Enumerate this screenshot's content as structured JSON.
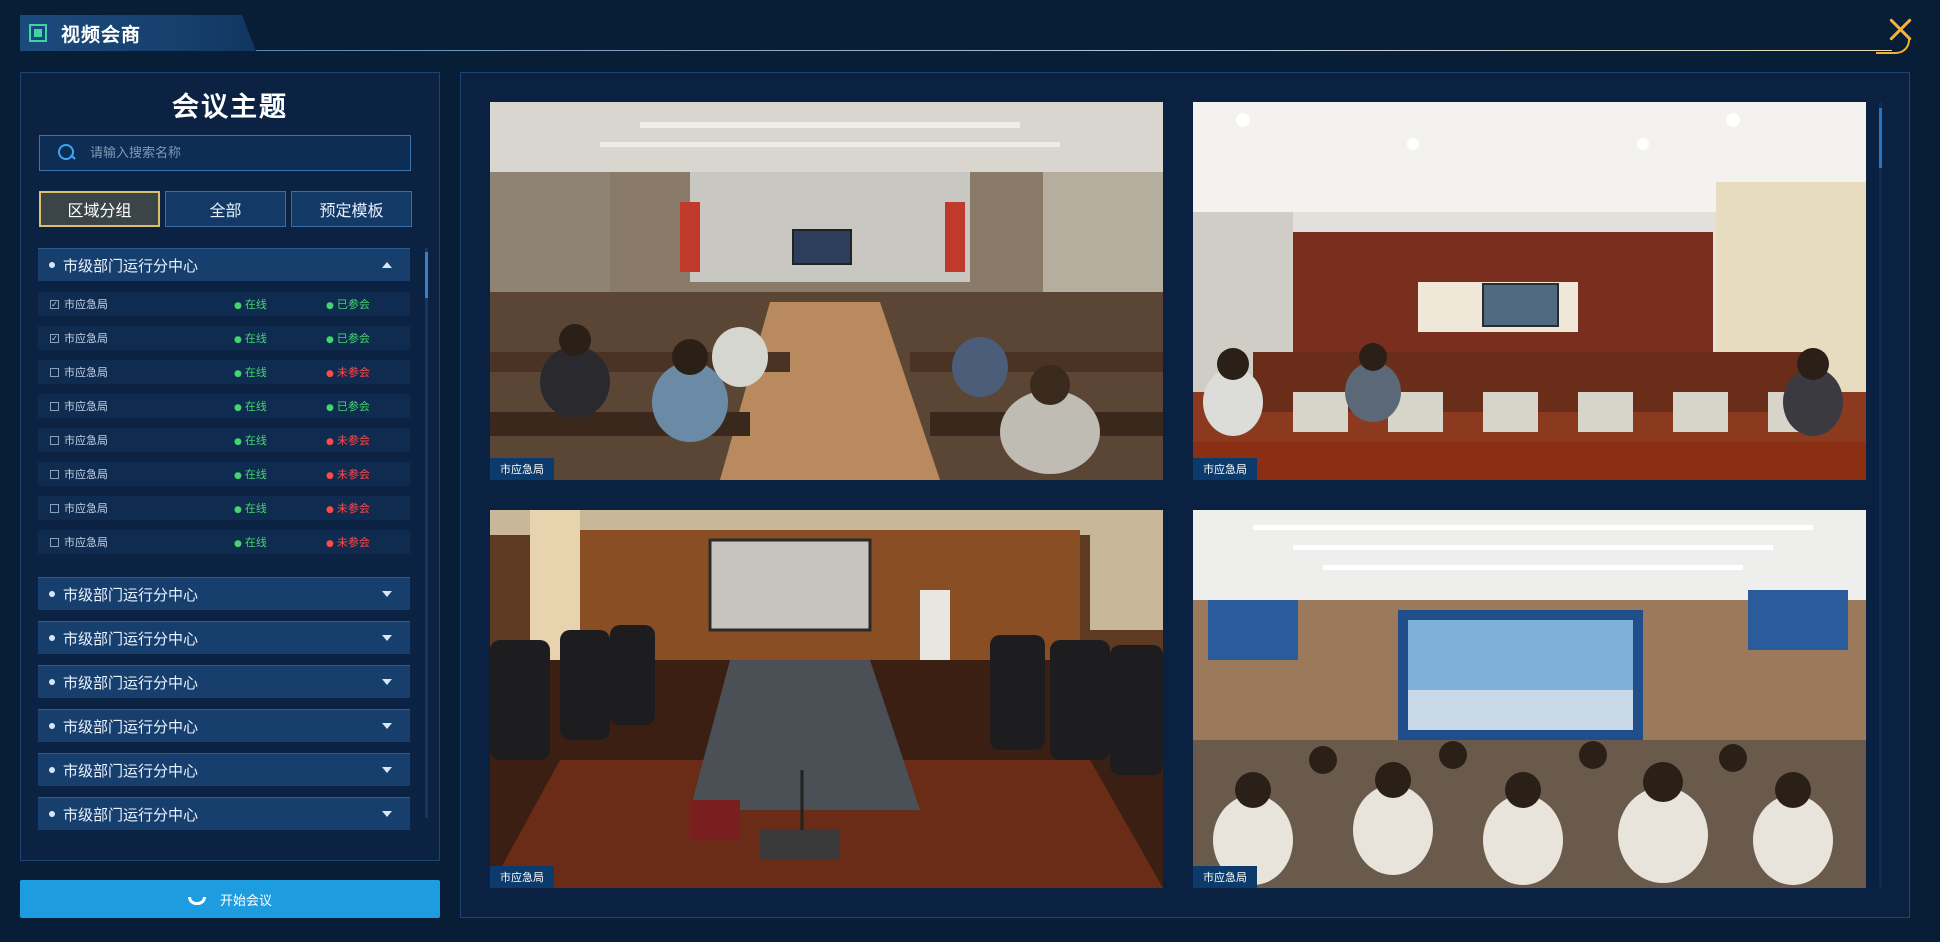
{
  "app": {
    "title": "视频会商"
  },
  "left": {
    "title": "会议主题",
    "search": {
      "placeholder": "请输入搜索名称",
      "value": ""
    },
    "tabs": [
      {
        "label": "区域分组",
        "active": true
      },
      {
        "label": "全部",
        "active": false
      },
      {
        "label": "预定模板",
        "active": false
      }
    ],
    "groups": [
      {
        "name": "市级部门运行分中心",
        "expanded": true,
        "members": [
          {
            "name": "市应急局",
            "checked": true,
            "online": "在线",
            "status": "已参会"
          },
          {
            "name": "市应急局",
            "checked": true,
            "online": "在线",
            "status": "已参会"
          },
          {
            "name": "市应急局",
            "checked": false,
            "online": "在线",
            "status": "未参会"
          },
          {
            "name": "市应急局",
            "checked": false,
            "online": "在线",
            "status": "已参会"
          },
          {
            "name": "市应急局",
            "checked": false,
            "online": "在线",
            "status": "未参会"
          },
          {
            "name": "市应急局",
            "checked": false,
            "online": "在线",
            "status": "未参会"
          },
          {
            "name": "市应急局",
            "checked": false,
            "online": "在线",
            "status": "未参会"
          },
          {
            "name": "市应急局",
            "checked": false,
            "online": "在线",
            "status": "未参会"
          }
        ]
      },
      {
        "name": "市级部门运行分中心",
        "expanded": false
      },
      {
        "name": "市级部门运行分中心",
        "expanded": false
      },
      {
        "name": "市级部门运行分中心",
        "expanded": false
      },
      {
        "name": "市级部门运行分中心",
        "expanded": false
      },
      {
        "name": "市级部门运行分中心",
        "expanded": false
      },
      {
        "name": "市级部门运行分中心",
        "expanded": false
      }
    ],
    "start_button": "开始会议"
  },
  "videos": [
    {
      "label": "市应急局"
    },
    {
      "label": "市应急局"
    },
    {
      "label": "市应急局"
    },
    {
      "label": "市应急局"
    }
  ],
  "colors": {
    "background": "#081d36",
    "accent": "#1d9ce0",
    "online": "#45d46e",
    "absent": "#ff4a4a",
    "close": "#f5b13a"
  }
}
